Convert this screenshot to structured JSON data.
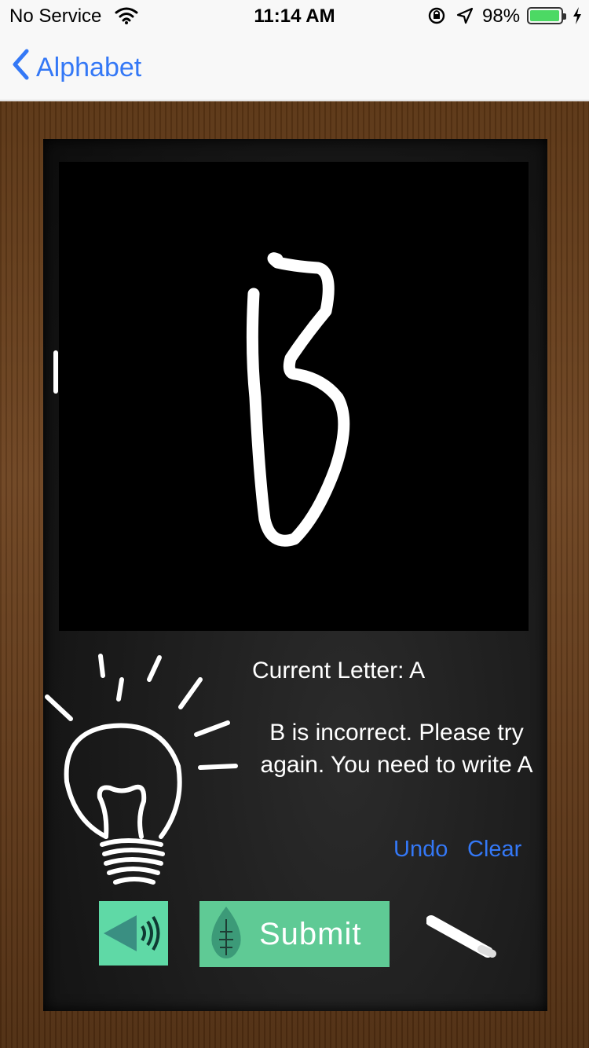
{
  "status_bar": {
    "carrier": "No Service",
    "time": "11:14 AM",
    "battery": "98%",
    "battery_level": 0.98
  },
  "nav": {
    "back_label": "Alphabet"
  },
  "lesson": {
    "current_letter_label": "Current Letter: A",
    "feedback": "B is incorrect. Please try again. You need to write A"
  },
  "actions": {
    "undo_label": "Undo",
    "clear_label": "Clear",
    "submit_label": "Submit"
  },
  "icons": {
    "wifi": "wifi-icon",
    "lock": "orientation-lock-icon",
    "location": "location-arrow-icon",
    "back": "chevron-left-icon",
    "speaker": "speaker-icon",
    "leaf": "leaf-icon",
    "chalk": "chalk-icon",
    "bulb": "lightbulb-icon"
  },
  "colors": {
    "accent": "#3478f6",
    "button_green": "#5fca95",
    "speaker_green": "#5fd9a6",
    "frame_brown": "#6e4421"
  }
}
